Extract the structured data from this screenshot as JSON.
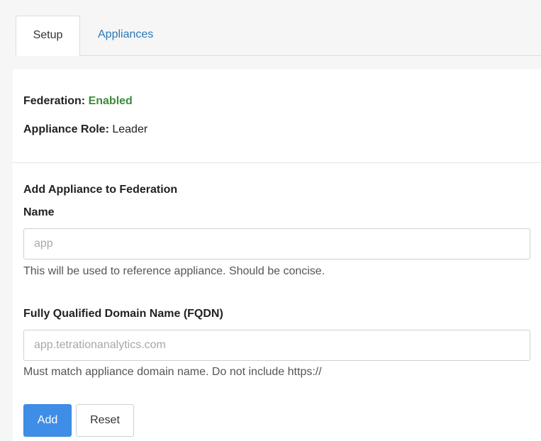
{
  "tabs": [
    {
      "label": "Setup",
      "active": true
    },
    {
      "label": "Appliances",
      "active": false
    }
  ],
  "status": {
    "federation_label": "Federation:",
    "federation_value": "Enabled",
    "role_label": "Appliance Role:",
    "role_value": "Leader"
  },
  "form": {
    "section_title": "Add Appliance to Federation",
    "name": {
      "label": "Name",
      "placeholder": "app",
      "value": "",
      "help": "This will be used to reference appliance. Should be concise."
    },
    "fqdn": {
      "label": "Fully Qualified Domain Name (FQDN)",
      "placeholder": "app.tetrationanalytics.com",
      "value": "",
      "help": "Must match appliance domain name. Do not include https://"
    },
    "buttons": {
      "add_label": "Add",
      "reset_label": "Reset"
    }
  },
  "colors": {
    "accent": "#3e8ee8",
    "link": "#2a7ab8",
    "enabled": "#3c8b3c"
  }
}
